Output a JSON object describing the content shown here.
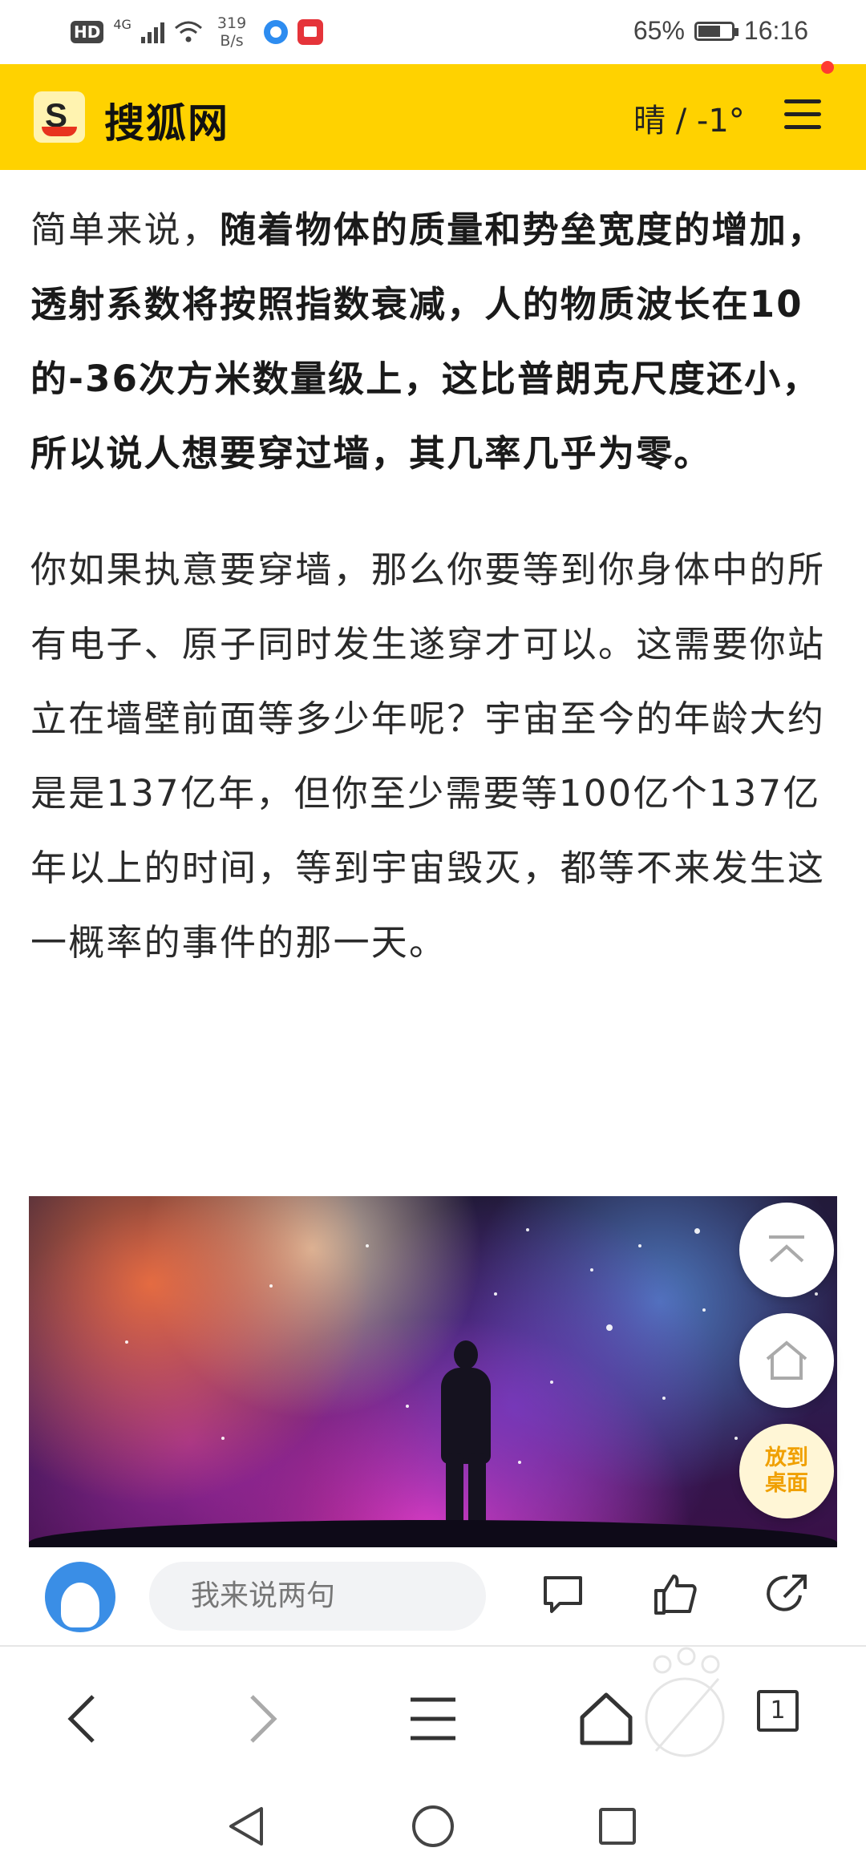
{
  "status_bar": {
    "hd": "HD",
    "network": "4G",
    "speed_value": "319",
    "speed_unit": "B/s",
    "battery": "65%",
    "time": "16:16"
  },
  "header": {
    "logo_letter": "S",
    "site_name": "搜狐网",
    "weather": "晴 / -1°",
    "accent_color": "#ffd200",
    "notification_dot_color": "#ff3b30"
  },
  "article": {
    "p1_plain": "简单来说，",
    "p1_bold": "随着物体的质量和势垒宽度的增加，透射系数将按照指数衰减，人的物质波长在10的-36次方米数量级上，这比普朗克尺度还小，所以说人想要穿过墙，其几率几乎为零。",
    "p2": "你如果执意要穿墙，那么你要等到你身体中的所有电子、原子同时发生遂穿才可以。这需要你站立在墙壁前面等多少年呢？宇宙至今的年龄大约是是137亿年，但你至少需要等100亿个137亿年以上的时间，等到宇宙毁灭，都等不来发生这一概率的事件的那一天。"
  },
  "floating": {
    "desktop_label_1": "放到",
    "desktop_label_2": "桌面"
  },
  "comment_bar": {
    "placeholder": "我来说两句"
  },
  "browser_nav": {
    "tab_count": "1"
  }
}
